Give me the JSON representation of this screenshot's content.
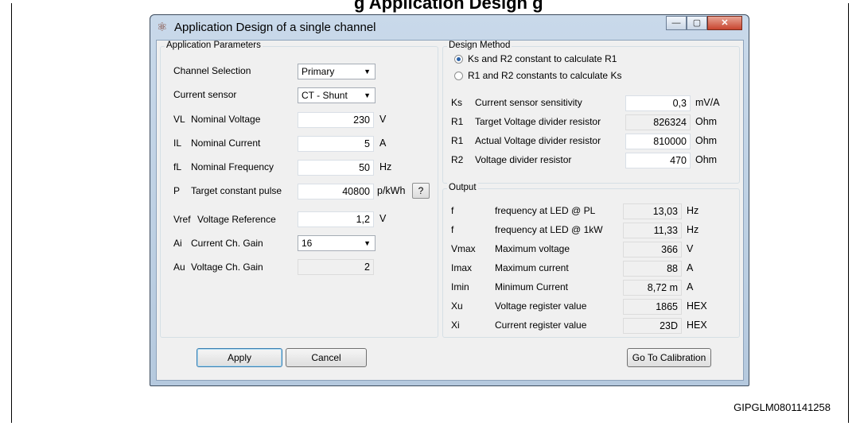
{
  "figure": {
    "caption": "g Application Design g",
    "id": "GIPGLM0801141258"
  },
  "window": {
    "title": "Application Design of a single channel",
    "buttons": {
      "minimize": "—",
      "maximize": "▢",
      "close": "✕"
    }
  },
  "app_params": {
    "group_title": "Application Parameters",
    "channel_selection": {
      "label": "Channel Selection",
      "value": "Primary"
    },
    "current_sensor": {
      "label": "Current sensor",
      "value": "CT - Shunt"
    },
    "rows": [
      {
        "sym": "VL",
        "label": "Nominal Voltage",
        "value": "230",
        "unit": "V"
      },
      {
        "sym": "IL",
        "label": "Nominal Current",
        "value": "5",
        "unit": "A"
      },
      {
        "sym": "fL",
        "label": "Nominal Frequency",
        "value": "50",
        "unit": "Hz"
      },
      {
        "sym": "P",
        "label": "Target constant pulse",
        "value": "40800",
        "unit": "p/kWh"
      }
    ],
    "help_label": "?",
    "vref": {
      "sym": "Vref",
      "label": "Voltage Reference",
      "value": "1,2",
      "unit": "V"
    },
    "ai": {
      "sym": "Ai",
      "label": "Current Ch. Gain",
      "value": "16"
    },
    "au": {
      "sym": "Au",
      "label": "Voltage Ch. Gain",
      "value": "2"
    }
  },
  "design": {
    "group_title": "Design Method",
    "radio1": "Ks and R2 constant to calculate R1",
    "radio2": "R1 and R2 constants to calculate Ks",
    "rows": [
      {
        "sym": "Ks",
        "label": "Current sensor sensitivity",
        "value": "0,3",
        "unit": "mV/A"
      },
      {
        "sym": "R1",
        "label": "Target Voltage divider resistor",
        "value": "826324",
        "unit": "Ohm"
      },
      {
        "sym": "R1",
        "label": "Actual Voltage divider resistor",
        "value": "810000",
        "unit": "Ohm"
      },
      {
        "sym": "R2",
        "label": "Voltage divider resistor",
        "value": "470",
        "unit": "Ohm"
      }
    ]
  },
  "output": {
    "group_title": "Output",
    "rows": [
      {
        "sym": "f",
        "label": "frequency at LED @ PL",
        "value": "13,03",
        "unit": "Hz"
      },
      {
        "sym": "f",
        "label": "frequency at LED @ 1kW",
        "value": "11,33",
        "unit": "Hz"
      },
      {
        "sym": "Vmax",
        "label": "Maximum voltage",
        "value": "366",
        "unit": "V"
      },
      {
        "sym": "Imax",
        "label": "Maximum current",
        "value": "88",
        "unit": "A"
      },
      {
        "sym": "Imin",
        "label": "Minimum Current",
        "value": "8,72 m",
        "unit": "A"
      },
      {
        "sym": "Xu",
        "label": "Voltage register value",
        "value": "1865",
        "unit": "HEX"
      },
      {
        "sym": "Xi",
        "label": "Current register value",
        "value": "23D",
        "unit": "HEX"
      }
    ]
  },
  "actions": {
    "apply": "Apply",
    "cancel": "Cancel",
    "calibration": "Go To Calibration"
  }
}
